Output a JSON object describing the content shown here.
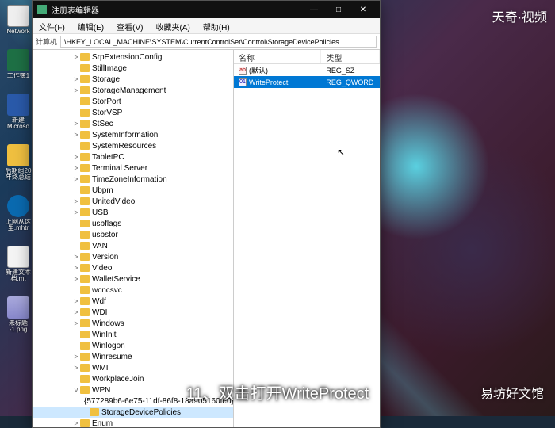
{
  "desktop": {
    "icons": [
      {
        "label": "Network",
        "cls": "net"
      },
      {
        "label": "工作簿1",
        "cls": "excel"
      },
      {
        "label": "新建\nMicroso",
        "cls": "doc"
      },
      {
        "label": "后期组20\n年终总结",
        "cls": "folder"
      },
      {
        "label": "上网从这\n里.mhtr",
        "cls": "edge"
      },
      {
        "label": "新建文本\n档.mt",
        "cls": "txt"
      },
      {
        "label": "未标题\n-1.png",
        "cls": "pic"
      }
    ]
  },
  "window": {
    "title": "注册表编辑器",
    "min": "—",
    "max": "□",
    "close": "✕"
  },
  "menu": {
    "items": [
      "文件(F)",
      "编辑(E)",
      "查看(V)",
      "收藏夹(A)",
      "帮助(H)"
    ]
  },
  "address": {
    "label": "计算机",
    "value": "\\HKEY_LOCAL_MACHINE\\SYSTEM\\CurrentControlSet\\Control\\StorageDevicePolicies"
  },
  "tree": {
    "nodes": [
      {
        "e": ">",
        "label": "SrpExtensionConfig"
      },
      {
        "e": "",
        "label": "StillImage"
      },
      {
        "e": ">",
        "label": "Storage"
      },
      {
        "e": ">",
        "label": "StorageManagement"
      },
      {
        "e": "",
        "label": "StorPort"
      },
      {
        "e": "",
        "label": "StorVSP"
      },
      {
        "e": ">",
        "label": "StSec"
      },
      {
        "e": ">",
        "label": "SystemInformation"
      },
      {
        "e": "",
        "label": "SystemResources"
      },
      {
        "e": ">",
        "label": "TabletPC"
      },
      {
        "e": ">",
        "label": "Terminal Server"
      },
      {
        "e": ">",
        "label": "TimeZoneInformation"
      },
      {
        "e": "",
        "label": "Ubpm"
      },
      {
        "e": ">",
        "label": "UnitedVideo"
      },
      {
        "e": ">",
        "label": "USB"
      },
      {
        "e": "",
        "label": "usbflags"
      },
      {
        "e": "",
        "label": "usbstor"
      },
      {
        "e": "",
        "label": "VAN"
      },
      {
        "e": ">",
        "label": "Version"
      },
      {
        "e": ">",
        "label": "Video"
      },
      {
        "e": ">",
        "label": "WalletService"
      },
      {
        "e": "",
        "label": "wcncsvc"
      },
      {
        "e": ">",
        "label": "Wdf"
      },
      {
        "e": ">",
        "label": "WDI"
      },
      {
        "e": ">",
        "label": "Windows"
      },
      {
        "e": "",
        "label": "WinInit"
      },
      {
        "e": "",
        "label": "Winlogon"
      },
      {
        "e": ">",
        "label": "Winresume"
      },
      {
        "e": ">",
        "label": "WMI"
      },
      {
        "e": "",
        "label": "WorkplaceJoin"
      },
      {
        "label": "WPN",
        "e": "v"
      },
      {
        "label": "{577289b6-6e75-11df-86f8-18a905160fe0}",
        "e": "",
        "deep": true
      },
      {
        "label": "StorageDevicePolicies",
        "e": "",
        "deep": true,
        "sel": true
      },
      {
        "label": "Enum",
        "e": ">"
      }
    ]
  },
  "list": {
    "columns": [
      "名称",
      "类型"
    ],
    "rows": [
      {
        "icon": "ab",
        "name": "(默认)",
        "type": "REG_SZ",
        "iconcls": "str"
      },
      {
        "icon": "01",
        "name": "WriteProtect",
        "type": "REG_QWORD",
        "iconcls": "bin",
        "sel": true
      }
    ]
  },
  "overlay": {
    "caption": "11、双击打开WriteProtect",
    "watermark_tr": "天奇·视频",
    "watermark_br": "易坊好文馆"
  }
}
